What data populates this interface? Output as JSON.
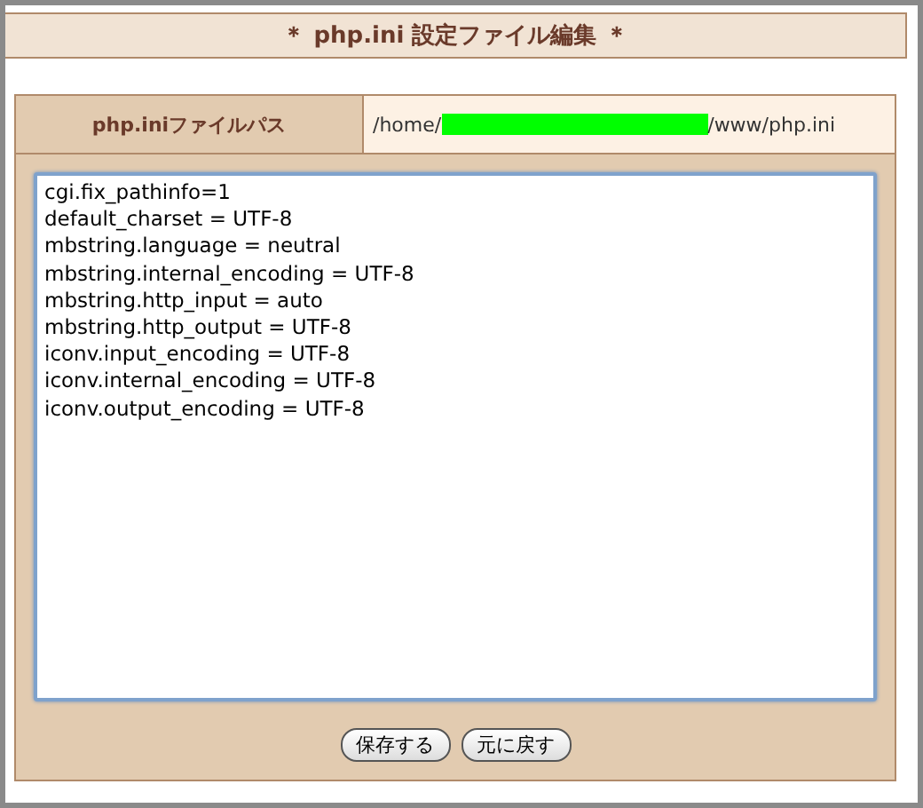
{
  "title": "＊ php.ini 設定ファイル編集 ＊",
  "path_row": {
    "label": "php.iniファイルパス",
    "prefix": "/home/",
    "suffix": "/www/php.ini",
    "redacted": true
  },
  "editor_lines": [
    "cgi.fix_pathinfo=1",
    "default_charset = UTF-8",
    "mbstring.language = neutral",
    "mbstring.internal_encoding = UTF-8",
    "mbstring.http_input = auto",
    "mbstring.http_output = UTF-8",
    "iconv.input_encoding = UTF-8",
    "iconv.internal_encoding = UTF-8",
    "iconv.output_encoding = UTF-8"
  ],
  "buttons": [
    "保存する",
    "元に戻す"
  ]
}
